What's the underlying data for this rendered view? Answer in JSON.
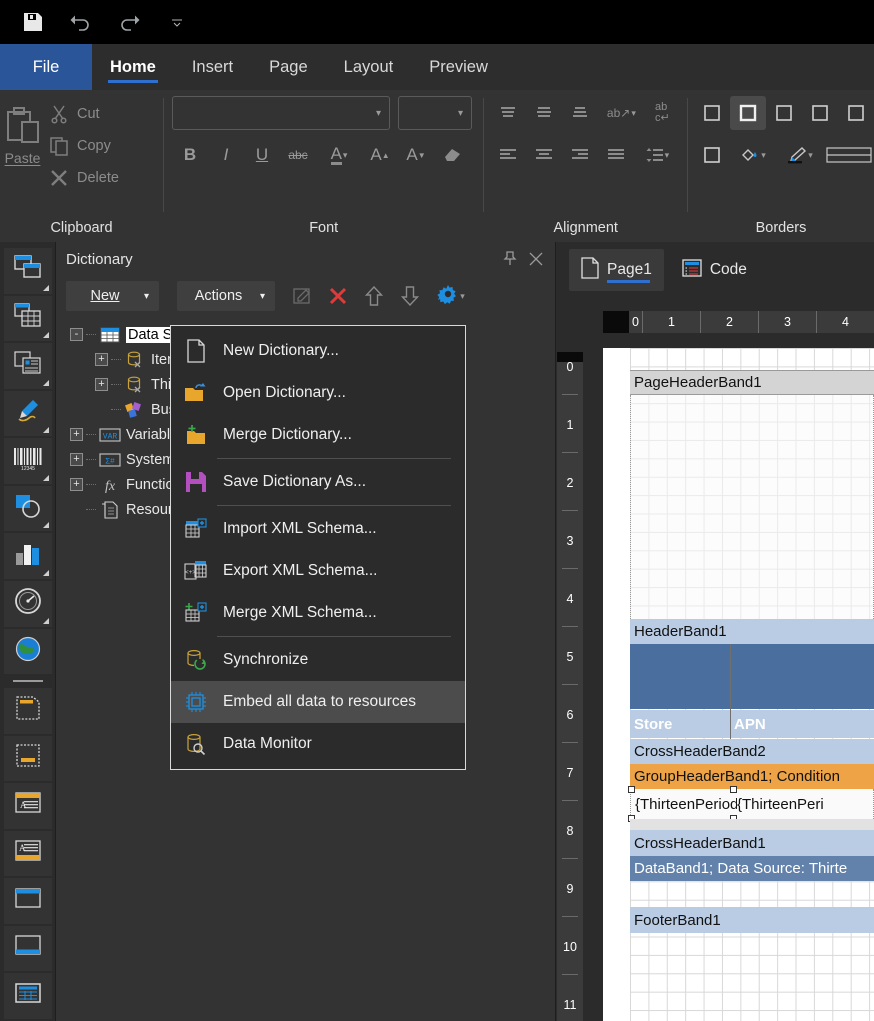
{
  "app": {
    "quick_access": [
      "save-icon",
      "undo-icon",
      "redo-icon",
      "customize-qat-icon"
    ]
  },
  "ribbon": {
    "tabs": [
      {
        "label": "File",
        "active": false,
        "file": true
      },
      {
        "label": "Home",
        "active": true
      },
      {
        "label": "Insert",
        "active": false
      },
      {
        "label": "Page",
        "active": false
      },
      {
        "label": "Layout",
        "active": false
      },
      {
        "label": "Preview",
        "active": false
      }
    ],
    "groups": [
      {
        "name": "Clipboard",
        "label": "Clipboard",
        "big_button": {
          "label": "Paste",
          "icon": "paste-icon"
        },
        "small_buttons": [
          {
            "label": "Cut",
            "icon": "cut-icon"
          },
          {
            "label": "Copy",
            "icon": "copy-icon"
          },
          {
            "label": "Delete",
            "icon": "delete-icon"
          }
        ]
      },
      {
        "name": "Font",
        "label": "Font",
        "font_name": {
          "value": "",
          "placeholder": ""
        },
        "font_size": {
          "value": "",
          "placeholder": ""
        },
        "buttons": [
          {
            "label": "B",
            "name": "bold-button"
          },
          {
            "label": "I",
            "name": "italic-button"
          },
          {
            "label": "U",
            "name": "underline-button"
          },
          {
            "label": "abc",
            "name": "strikethrough-button"
          },
          {
            "label": "A",
            "name": "font-color-button"
          },
          {
            "label": "A",
            "name": "grow-font-button"
          },
          {
            "label": "A",
            "name": "shrink-font-button"
          },
          {
            "label": "",
            "name": "clear-formatting-button"
          }
        ]
      },
      {
        "name": "Alignment",
        "label": "Alignment",
        "row1": [
          "align-top-icon",
          "align-middle-icon",
          "align-bottom-icon",
          "text-direction-icon",
          "word-wrap-icon"
        ],
        "row2": [
          "align-left-icon",
          "align-center-icon",
          "align-right-icon",
          "justify-icon",
          "line-spacing-icon"
        ]
      },
      {
        "name": "Borders",
        "label": "Borders",
        "row1": [
          "border-none-icon",
          "border-all-icon",
          "border-left-icon",
          "border-right-icon",
          "border-top-icon"
        ],
        "row2": [
          "border-bottom-icon",
          "fill-color-icon",
          "border-color-icon",
          "border-style-icon"
        ]
      }
    ]
  },
  "toolbox": {
    "items": [
      {
        "name": "sidebar-item-panels",
        "icon": "panels-icon"
      },
      {
        "name": "sidebar-item-table",
        "icon": "table-icon"
      },
      {
        "name": "sidebar-item-cross-tab",
        "icon": "cross-tab-icon"
      },
      {
        "name": "sidebar-item-drawings",
        "icon": "pen-icon"
      },
      {
        "name": "sidebar-item-barcode",
        "icon": "barcode-icon"
      },
      {
        "name": "sidebar-item-shapes",
        "icon": "shapes-icon"
      },
      {
        "name": "sidebar-item-chart",
        "icon": "chart-icon"
      },
      {
        "name": "sidebar-item-gauge",
        "icon": "gauge-icon"
      },
      {
        "name": "sidebar-item-map",
        "icon": "globe-icon"
      },
      {
        "name": "sidebar-item-report-title-band",
        "icon": "report-title-band-icon"
      },
      {
        "name": "sidebar-item-report-summary-band",
        "icon": "report-summary-band-icon"
      },
      {
        "name": "sidebar-item-page-header-band",
        "icon": "page-header-band-icon"
      },
      {
        "name": "sidebar-item-page-footer-band",
        "icon": "page-footer-band-icon"
      },
      {
        "name": "sidebar-item-header-band",
        "icon": "header-band-icon"
      },
      {
        "name": "sidebar-item-footer-band",
        "icon": "footer-band-icon"
      },
      {
        "name": "sidebar-item-data-band",
        "icon": "data-band-icon"
      }
    ]
  },
  "dictionary": {
    "title": "Dictionary",
    "pin_icon": "pin-icon",
    "close_icon": "close-icon",
    "toolbar": {
      "new_label": "New",
      "actions_label": "Actions",
      "edit_icon": "edit-icon",
      "remove_icon": "remove-icon",
      "move_up_icon": "arrow-up-icon",
      "move_down_icon": "arrow-down-icon",
      "settings_icon": "gear-icon"
    },
    "tree": [
      {
        "label": "Data Sources",
        "icon": "data-sources-icon",
        "expander": "-",
        "indent": 0,
        "selected": true
      },
      {
        "label": "Item",
        "icon": "data-source-icon",
        "expander": "+",
        "indent": 1,
        "selected": false
      },
      {
        "label": "Thir",
        "icon": "data-source-icon",
        "expander": "+",
        "indent": 1,
        "selected": false
      },
      {
        "label": "Busines",
        "icon": "business-objects-icon",
        "expander": "",
        "indent": 1,
        "selected": false
      },
      {
        "label": "Variable",
        "icon": "variables-icon",
        "expander": "+",
        "indent": 0,
        "selected": false
      },
      {
        "label": "System",
        "icon": "system-variables-icon",
        "expander": "+",
        "indent": 0,
        "selected": false
      },
      {
        "label": "Functio",
        "icon": "functions-icon",
        "expander": "+",
        "indent": 0,
        "selected": false
      },
      {
        "label": "Resour",
        "icon": "resources-icon",
        "expander": "",
        "indent": 0,
        "selected": false
      }
    ]
  },
  "actions_menu": {
    "items": [
      {
        "label": "New Dictionary...",
        "icon": "new-document-icon",
        "highlighted": false,
        "separator_after": false
      },
      {
        "label": "Open Dictionary...",
        "icon": "open-folder-icon",
        "highlighted": false,
        "separator_after": false
      },
      {
        "label": "Merge Dictionary...",
        "icon": "merge-folder-icon",
        "highlighted": false,
        "separator_after": true
      },
      {
        "label": "Save Dictionary As...",
        "icon": "save-floppy-icon",
        "highlighted": false,
        "separator_after": true
      },
      {
        "label": "Import XML Schema...",
        "icon": "import-xml-icon",
        "highlighted": false,
        "separator_after": false
      },
      {
        "label": "Export XML Schema...",
        "icon": "export-xml-icon",
        "highlighted": false,
        "separator_after": false
      },
      {
        "label": "Merge XML Schema...",
        "icon": "merge-xml-icon",
        "highlighted": false,
        "separator_after": true
      },
      {
        "label": "Synchronize",
        "icon": "synchronize-icon",
        "highlighted": false,
        "separator_after": false
      },
      {
        "label": "Embed all data to resources",
        "icon": "embed-data-icon",
        "highlighted": true,
        "separator_after": false
      },
      {
        "label": "Data Monitor",
        "icon": "data-monitor-icon",
        "highlighted": false,
        "separator_after": false
      }
    ]
  },
  "designer": {
    "tabs": [
      {
        "label": "Page1",
        "icon": "page-icon",
        "active": true
      },
      {
        "label": "Code",
        "icon": "code-icon",
        "active": false
      }
    ],
    "h_ruler_ticks": [
      "0",
      "1",
      "2",
      "3",
      "4"
    ],
    "v_ruler_ticks": [
      "0",
      "1",
      "2",
      "3",
      "4",
      "5",
      "6",
      "7",
      "8",
      "9",
      "10",
      "11"
    ],
    "bands": [
      {
        "name": "page-header-band",
        "label": "PageHeaderBand1",
        "style": "pageheader"
      },
      {
        "name": "header-band",
        "label": "HeaderBand1",
        "style": "light"
      },
      {
        "name": "header-band-fill",
        "label": "",
        "style": "fill"
      },
      {
        "name": "column-headers",
        "labels": [
          "Store",
          "APN"
        ],
        "style": "cols"
      },
      {
        "name": "cross-header-band-2",
        "label": "CrossHeaderBand2",
        "style": "light"
      },
      {
        "name": "group-header-band",
        "label": "GroupHeaderBand1; Condition",
        "style": "orange"
      },
      {
        "name": "expression-row",
        "labels": [
          "{ThirteenPeriodTabl",
          "{ThirteenPeri"
        ],
        "style": "expr"
      },
      {
        "name": "cross-header-band-1",
        "label": "CrossHeaderBand1",
        "style": "light"
      },
      {
        "name": "data-band",
        "label": "DataBand1; Data Source: Thirte",
        "style": "mid"
      },
      {
        "name": "footer-band",
        "label": "FooterBand1",
        "style": "light"
      }
    ]
  },
  "colors": {
    "accent": "#2f6fd0",
    "file_tab": "#2a5699",
    "band_light": "#b9cce4",
    "band_mid": "#6282ab",
    "band_orange": "#eda346",
    "band_header_fill": "#4a6f9e",
    "menu_highlight": "#4c4c4c"
  }
}
